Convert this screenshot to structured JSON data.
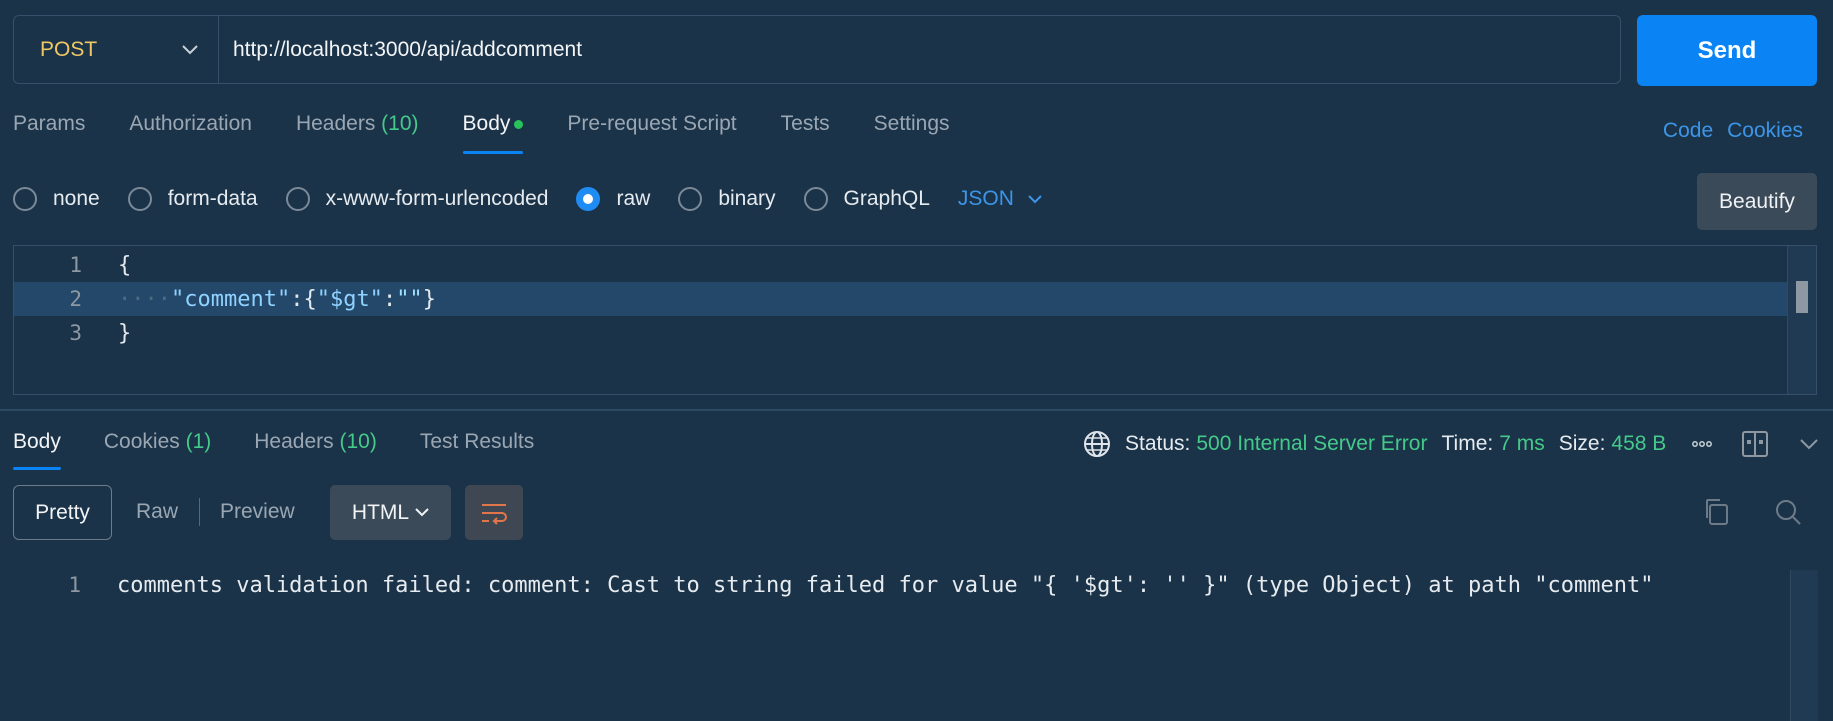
{
  "request": {
    "method": "POST",
    "url": "http://localhost:3000/api/addcomment",
    "send_label": "Send"
  },
  "request_tabs": [
    {
      "label": "Params"
    },
    {
      "label": "Authorization"
    },
    {
      "label": "Headers",
      "count": "(10)"
    },
    {
      "label": "Body"
    },
    {
      "label": "Pre-request Script"
    },
    {
      "label": "Tests"
    },
    {
      "label": "Settings"
    }
  ],
  "right_links": {
    "code": "Code",
    "cookies": "Cookies"
  },
  "body_types": {
    "none": "none",
    "form_data": "form-data",
    "urlencoded": "x-www-form-urlencoded",
    "raw": "raw",
    "binary": "binary",
    "graphql": "GraphQL",
    "format": "JSON",
    "selected": "raw"
  },
  "beautify_label": "Beautify",
  "editor": {
    "lines": [
      {
        "num": "1",
        "text": "{"
      },
      {
        "num": "2",
        "indent": "····",
        "key": "\"comment\"",
        "rest_a": ":{",
        "key2": "\"$gt\"",
        "rest_b": ":",
        "val": "\"\"",
        "rest_c": "}"
      },
      {
        "num": "3",
        "text": "}"
      }
    ]
  },
  "response_tabs": [
    {
      "label": "Body"
    },
    {
      "label": "Cookies",
      "count": "(1)"
    },
    {
      "label": "Headers",
      "count": "(10)"
    },
    {
      "label": "Test Results"
    }
  ],
  "status": {
    "status_label": "Status:",
    "status_value": "500 Internal Server Error",
    "time_label": "Time:",
    "time_value": "7 ms",
    "size_label": "Size:",
    "size_value": "458 B"
  },
  "view": {
    "pretty": "Pretty",
    "raw": "Raw",
    "preview": "Preview",
    "format": "HTML"
  },
  "response": {
    "line_num": "1",
    "text": "comments validation failed: comment: Cast to string failed for value \"{ '$gt': '' }\" (type Object) at path \"comment\""
  },
  "colors": {
    "background": "#1b3349",
    "accent": "#0a84f5",
    "method": "#f1c765",
    "success_green": "#45c98a"
  }
}
